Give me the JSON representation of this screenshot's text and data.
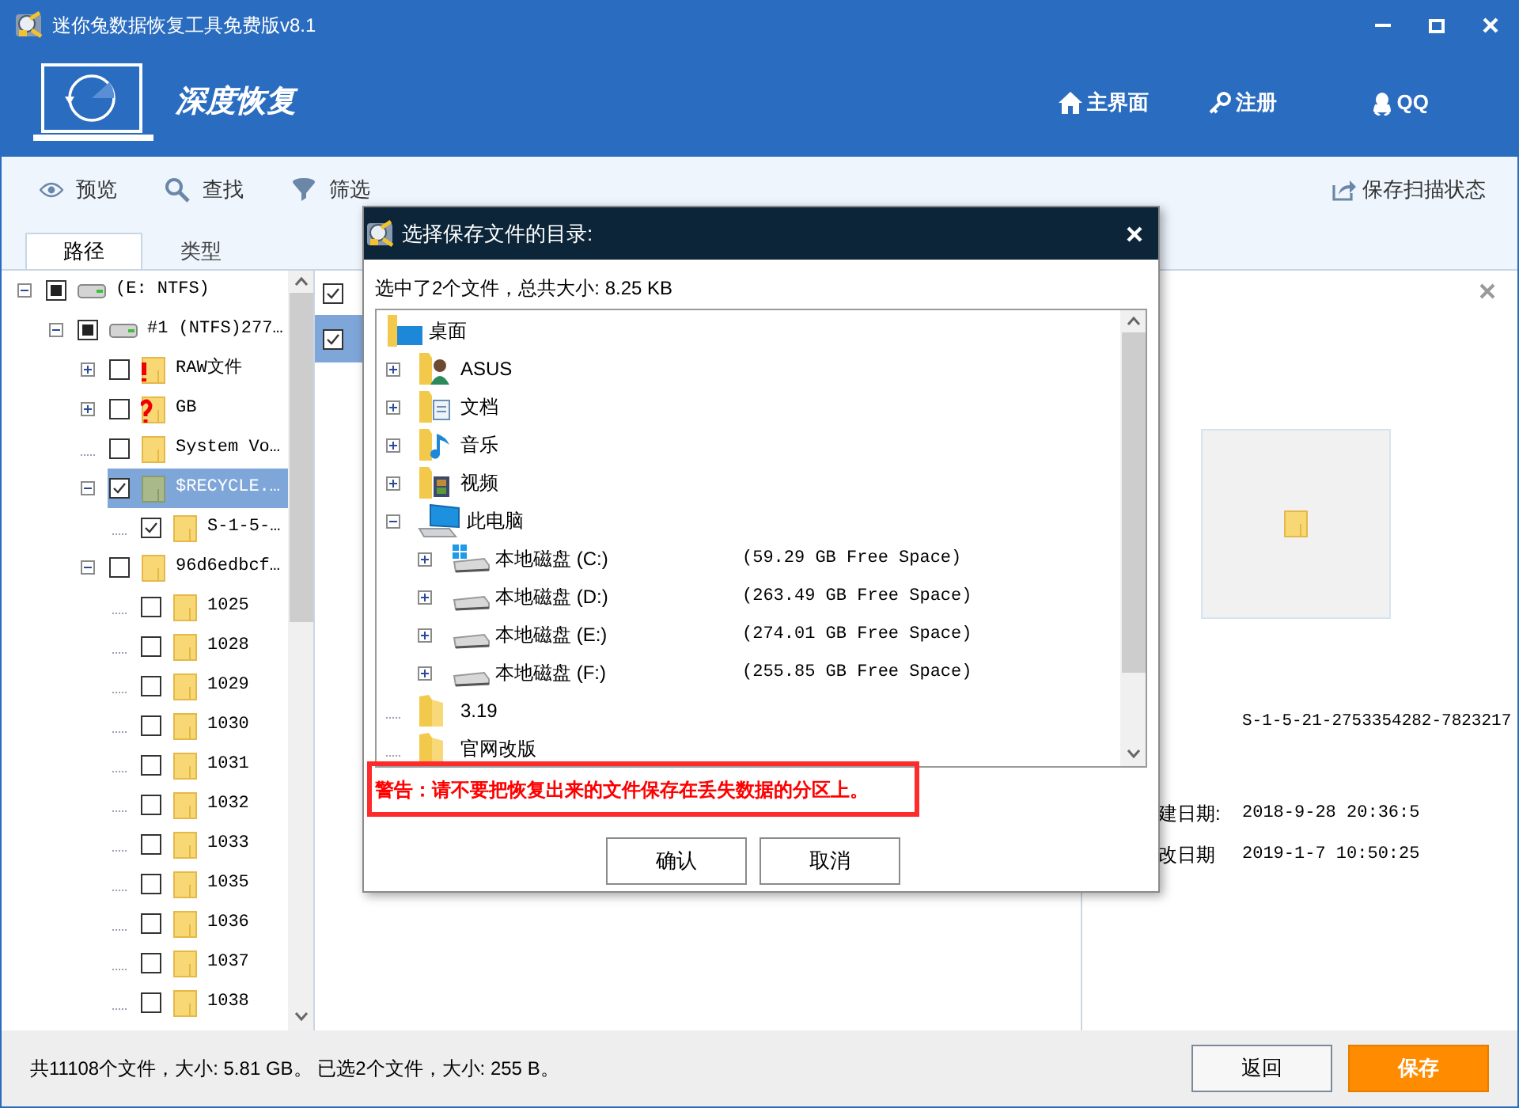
{
  "window": {
    "title": "迷你兔数据恢复工具免费版v8.1"
  },
  "header": {
    "product": "深度恢复",
    "nav": [
      {
        "label": "主界面",
        "kind": "home"
      },
      {
        "label": "注册",
        "kind": "key"
      },
      {
        "label": "QQ",
        "kind": "qq"
      }
    ]
  },
  "toolbar": {
    "items": [
      {
        "label": "预览",
        "kind": "eye"
      },
      {
        "label": "查找",
        "kind": "search"
      },
      {
        "label": "筛选",
        "kind": "filter"
      }
    ],
    "save_state": "保存扫描状态"
  },
  "tabs": [
    {
      "label": "路径",
      "selected": true
    },
    {
      "label": "类型",
      "selected": false
    }
  ],
  "tree": [
    {
      "label": "(E: NTFS)",
      "kind": "drive",
      "expanded": true,
      "checked": false,
      "partial": true,
      "selected": false,
      "children": [
        {
          "label": "#1 (NTFS)277…",
          "kind": "drive",
          "expanded": true,
          "checked": false,
          "partial": true,
          "selected": false,
          "children": [
            {
              "label": "RAW文件",
              "kind": "folder-warning",
              "expanded": false,
              "checked": false,
              "selected": false
            },
            {
              "label": "GB",
              "kind": "folder-unknown",
              "expanded": false,
              "checked": false,
              "selected": false
            },
            {
              "label": "System Vo…",
              "kind": "folder",
              "checked": false,
              "selected": false
            },
            {
              "label": "$RECYCLE.…",
              "kind": "folder-recycle",
              "expanded": true,
              "checked": true,
              "selected": true,
              "children": [
                {
                  "label": "S-1-5-…",
                  "kind": "folder",
                  "checked": true,
                  "selected": false
                }
              ]
            },
            {
              "label": "96d6edbcf…",
              "kind": "folder",
              "expanded": true,
              "checked": false,
              "selected": false,
              "children": [
                {
                  "label": "1025",
                  "kind": "folder",
                  "checked": false,
                  "selected": false
                },
                {
                  "label": "1028",
                  "kind": "folder",
                  "checked": false,
                  "selected": false
                },
                {
                  "label": "1029",
                  "kind": "folder",
                  "checked": false,
                  "selected": false
                },
                {
                  "label": "1030",
                  "kind": "folder",
                  "checked": false,
                  "selected": false
                },
                {
                  "label": "1031",
                  "kind": "folder",
                  "checked": false,
                  "selected": false
                },
                {
                  "label": "1032",
                  "kind": "folder",
                  "checked": false,
                  "selected": false
                },
                {
                  "label": "1033",
                  "kind": "folder",
                  "checked": false,
                  "selected": false
                },
                {
                  "label": "1035",
                  "kind": "folder",
                  "checked": false,
                  "selected": false
                },
                {
                  "label": "1036",
                  "kind": "folder",
                  "checked": false,
                  "selected": false
                },
                {
                  "label": "1037",
                  "kind": "folder",
                  "checked": false,
                  "selected": false
                },
                {
                  "label": "1038",
                  "kind": "folder",
                  "checked": false,
                  "selected": false
                }
              ]
            }
          ]
        }
      ]
    }
  ],
  "file_list": {
    "header_checked": true,
    "rows": [
      {
        "checked": true,
        "selected": true
      }
    ]
  },
  "details": {
    "name": "S-1-5-21-2753354282-7823217",
    "fields": [
      {
        "label": "建日期:",
        "value": "2018-9-28 20:36:5"
      },
      {
        "label": "改日期",
        "value": "2019-1-7 10:50:25"
      }
    ]
  },
  "status_bar": {
    "text": "共11108个文件，大小: 5.81 GB。 已选2个文件，大小: 255 B。",
    "buttons": [
      {
        "label": "返回",
        "kind": "secondary"
      },
      {
        "label": "保存",
        "kind": "primary"
      }
    ]
  },
  "dialog": {
    "title": "选择保存文件的目录:",
    "summary": "选中了2个文件，总共大小: 8.25 KB",
    "tree": [
      {
        "label": "桌面",
        "kind": "desktop",
        "children": [
          {
            "label": "ASUS",
            "kind": "user",
            "expanded": false
          },
          {
            "label": "文档",
            "kind": "documents",
            "expanded": false
          },
          {
            "label": "音乐",
            "kind": "music",
            "expanded": false
          },
          {
            "label": "视频",
            "kind": "video",
            "expanded": false
          },
          {
            "label": "此电脑",
            "kind": "computer",
            "expanded": true,
            "children": [
              {
                "label": "本地磁盘 (C:)",
                "kind": "system-drive",
                "expanded": false,
                "free": "(59.29 GB Free Space)"
              },
              {
                "label": "本地磁盘 (D:)",
                "kind": "drive",
                "expanded": false,
                "free": "(263.49 GB Free Space)"
              },
              {
                "label": "本地磁盘 (E:)",
                "kind": "drive",
                "expanded": false,
                "free": "(274.01 GB Free Space)"
              },
              {
                "label": "本地磁盘 (F:)",
                "kind": "drive",
                "expanded": false,
                "free": "(255.85 GB Free Space)"
              }
            ]
          },
          {
            "label": "3.19",
            "kind": "folder"
          },
          {
            "label": "官网改版",
            "kind": "folder"
          }
        ]
      }
    ],
    "warning": {
      "text": "警告：请不要把恢复出来的文件保存在丢失数据的分区上。",
      "highlighted": true
    },
    "buttons": [
      "确认",
      "取消"
    ]
  }
}
